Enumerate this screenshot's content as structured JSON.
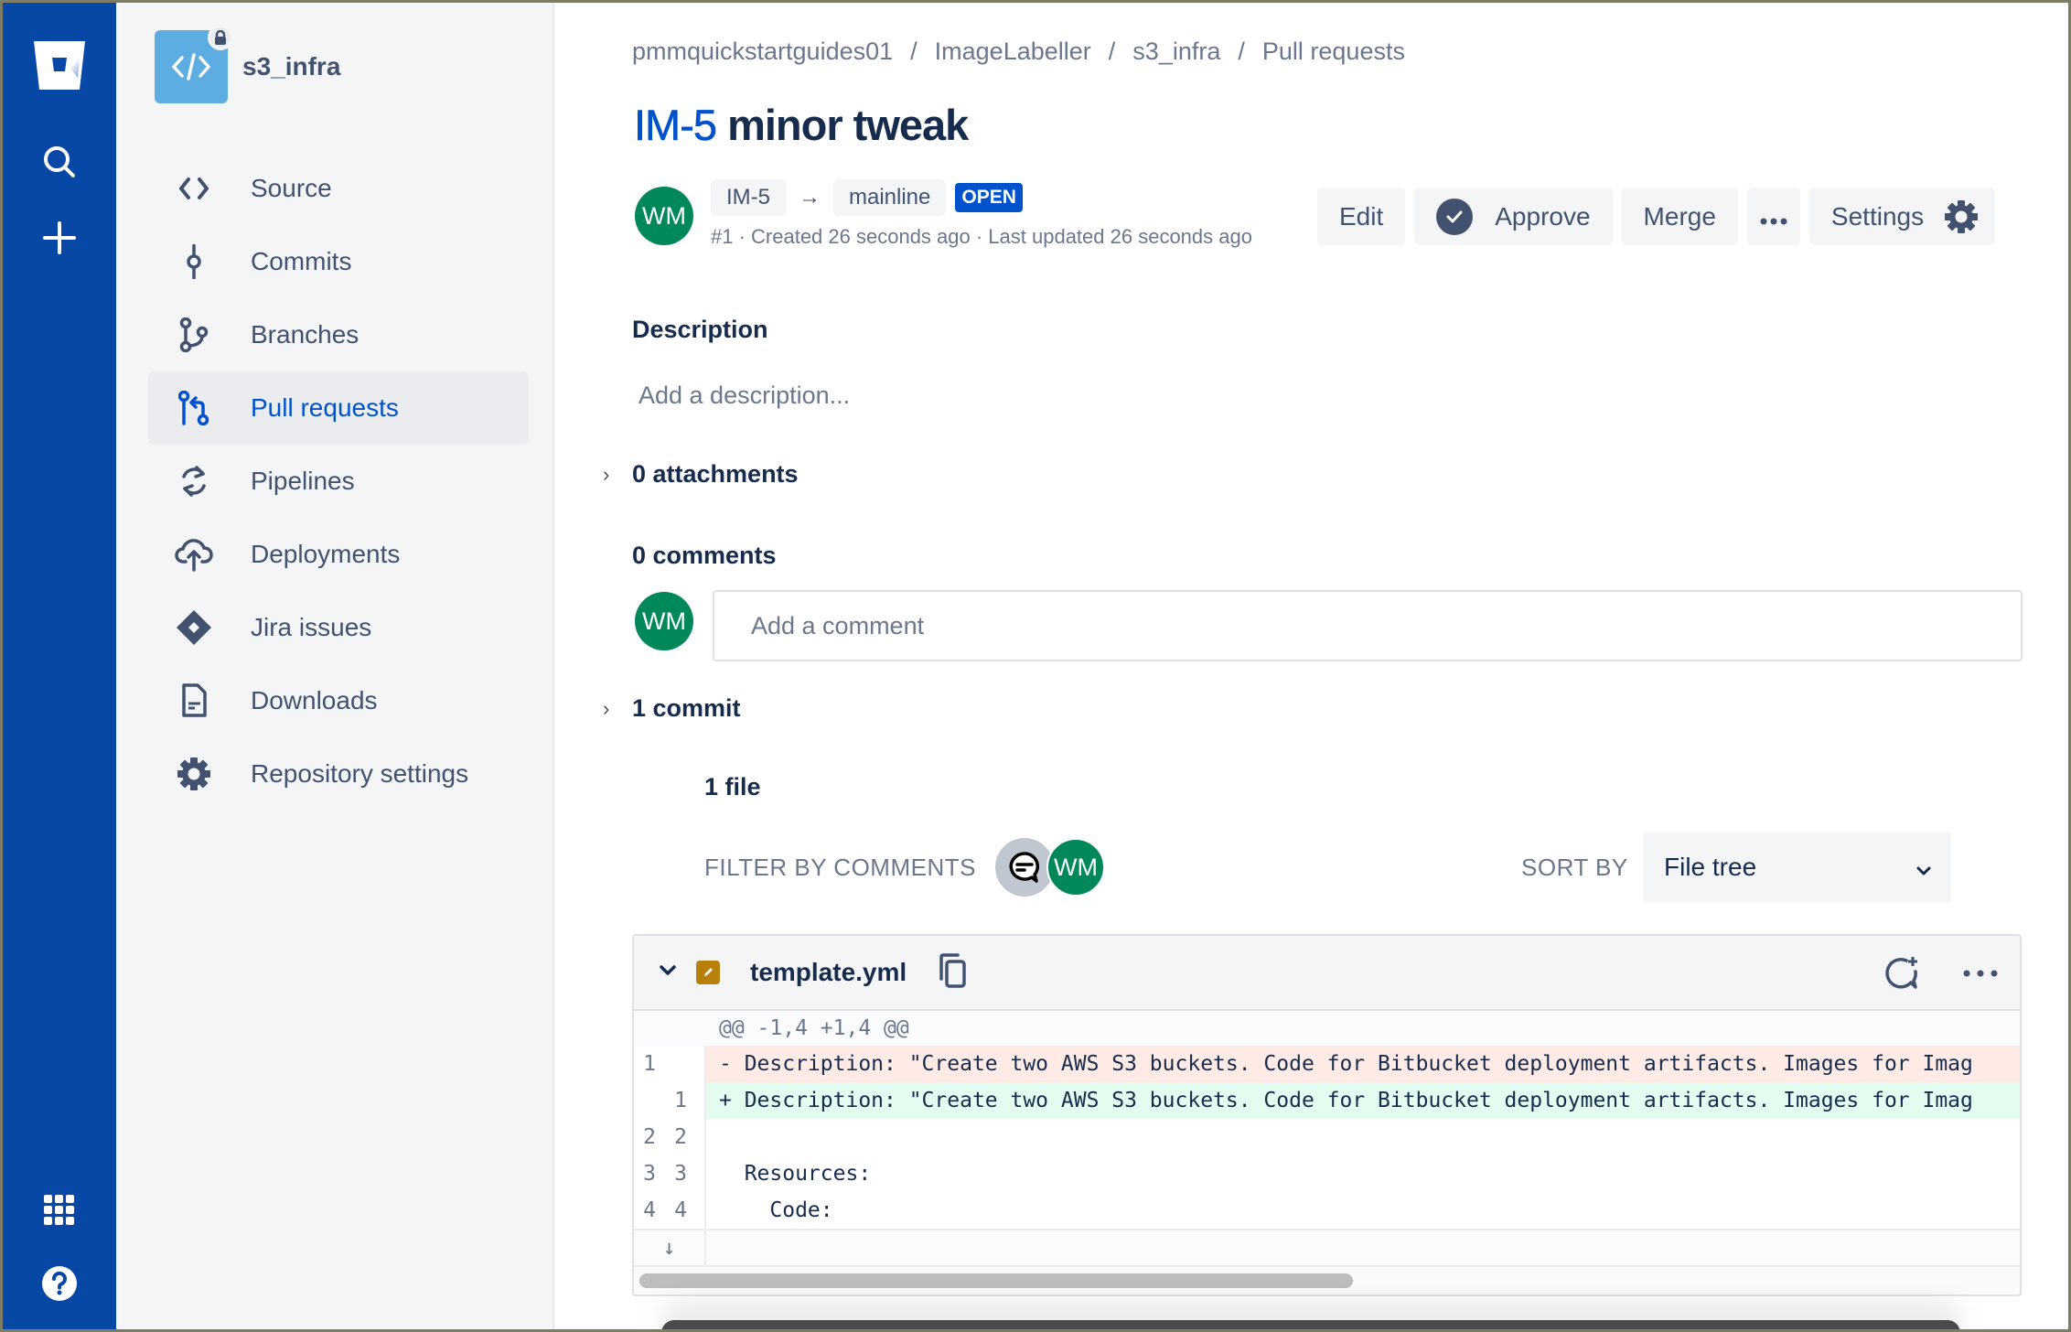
{
  "global_nav": {
    "icons": [
      "bitbucket-logo",
      "search-icon",
      "create-icon",
      "app-switcher-icon",
      "help-icon"
    ]
  },
  "repo": {
    "name": "s3_infra",
    "private": true
  },
  "sidebar": {
    "items": [
      {
        "label": "Source",
        "icon": "source-icon",
        "active": false
      },
      {
        "label": "Commits",
        "icon": "commits-icon",
        "active": false
      },
      {
        "label": "Branches",
        "icon": "branches-icon",
        "active": false
      },
      {
        "label": "Pull requests",
        "icon": "pull-request-icon",
        "active": true
      },
      {
        "label": "Pipelines",
        "icon": "pipelines-icon",
        "active": false
      },
      {
        "label": "Deployments",
        "icon": "deployments-icon",
        "active": false
      },
      {
        "label": "Jira issues",
        "icon": "jira-icon",
        "active": false
      },
      {
        "label": "Downloads",
        "icon": "downloads-icon",
        "active": false
      },
      {
        "label": "Repository settings",
        "icon": "settings-icon",
        "active": false
      }
    ]
  },
  "breadcrumb": [
    "pmmquickstartguides01",
    "ImageLabeller",
    "s3_infra",
    "Pull requests"
  ],
  "breadcrumb_sep": "/",
  "pr": {
    "key": "IM-5",
    "title": "minor tweak",
    "author_initials": "WM",
    "source_branch": "IM-5",
    "arrow": "→",
    "target_branch": "mainline",
    "status": "OPEN",
    "meta": "#1 · Created 26 seconds ago · Last updated 26 seconds ago"
  },
  "actions": {
    "edit": "Edit",
    "approve": "Approve",
    "merge": "Merge",
    "more": "•••",
    "settings": "Settings"
  },
  "description": {
    "heading": "Description",
    "placeholder": "Add a description..."
  },
  "attachments": {
    "label": "0 attachments",
    "chevron": "›"
  },
  "comments": {
    "heading": "0 comments",
    "placeholder": "Add a comment",
    "avatar_initials": "WM"
  },
  "commits": {
    "label": "1 commit",
    "chevron": "›"
  },
  "files": {
    "heading": "1 file",
    "filter_label": "FILTER BY COMMENTS",
    "filter_avatar_initials": "WM",
    "sort_label": "SORT BY",
    "sort_value": "File tree",
    "file": {
      "name": "template.yml",
      "status": "modified",
      "hunk": "@@ -1,4 +1,4 @@",
      "lines": [
        {
          "old": "1",
          "new": "",
          "type": "del",
          "text": "- Description: \"Create two AWS S3 buckets. Code for Bitbucket deployment artifacts. Images for Imag"
        },
        {
          "old": "",
          "new": "1",
          "type": "add",
          "text": "+ Description: \"Create two AWS S3 buckets. Code for Bitbucket deployment artifacts. Images for Imag"
        },
        {
          "old": "2",
          "new": "2",
          "type": "ctx",
          "text": ""
        },
        {
          "old": "3",
          "new": "3",
          "type": "ctx",
          "text": "  Resources:"
        },
        {
          "old": "4",
          "new": "4",
          "type": "ctx",
          "text": "    Code:"
        }
      ],
      "expand_icon": "↓"
    }
  },
  "colors": {
    "global_nav": "#0747A6",
    "accent": "#0052CC",
    "avatar_green": "#00875A",
    "deleted_bg": "#FFEBE6",
    "added_bg": "#E3FCEF",
    "modified_badge": "#B7800A"
  }
}
